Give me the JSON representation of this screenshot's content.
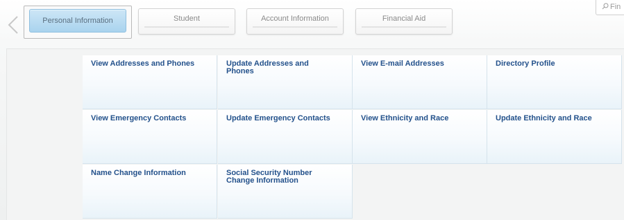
{
  "tabs": [
    {
      "label": "Personal Information"
    },
    {
      "label": "Student"
    },
    {
      "label": "Account Information"
    },
    {
      "label": "Financial Aid"
    }
  ],
  "search": {
    "placeholder": "Fin"
  },
  "tiles": [
    {
      "label": "View Addresses and Phones"
    },
    {
      "label": "Update Addresses and Phones"
    },
    {
      "label": "View E-mail Addresses"
    },
    {
      "label": "Directory Profile"
    },
    {
      "label": "View Emergency Contacts"
    },
    {
      "label": "Update Emergency Contacts"
    },
    {
      "label": "View Ethnicity and Race"
    },
    {
      "label": "Update Ethnicity and Race"
    },
    {
      "label": "Name Change Information"
    },
    {
      "label": "Social Security Number Change Information"
    }
  ],
  "colors": {
    "accent_tab": "#a9d3ee",
    "tile_link": "#23518b"
  },
  "icons": {
    "back": "chevron-left-icon",
    "search": "search-icon"
  }
}
